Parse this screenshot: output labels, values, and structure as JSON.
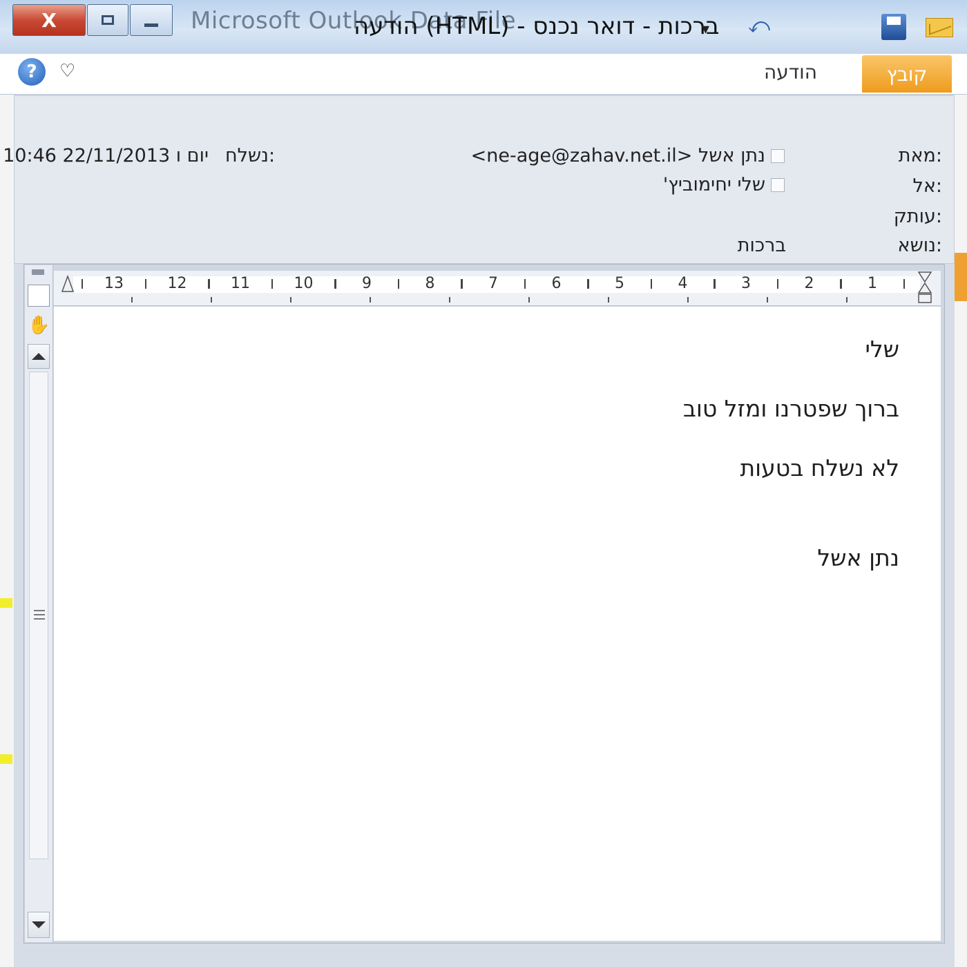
{
  "window": {
    "title": "הודעה (HTML) - ברכות - דואר נכנס",
    "background_title": "Microsoft Outlook Data File",
    "close_label": "X"
  },
  "ribbon": {
    "tabs": [
      {
        "label": "קובץ",
        "active": true
      },
      {
        "label": "הודעה",
        "active": false
      }
    ],
    "help_label": "?"
  },
  "header": {
    "from_label": "מאת:",
    "from_value": "נתן אשל <ne-age@zahav.net.il>",
    "to_label": "אל:",
    "to_value": "שלי יחימוביץ'",
    "cc_label": "עותק:",
    "subject_label": "נושא:",
    "subject_value": "ברכות",
    "sent_label": "נשלח:",
    "sent_value": "יום ו 22/11/2013 10:46"
  },
  "ruler": {
    "numbers": [
      "13",
      "12",
      "11",
      "10",
      "9",
      "8",
      "7",
      "6",
      "5",
      "4",
      "3",
      "2",
      "1"
    ]
  },
  "body": {
    "lines": [
      "שלי",
      "ברוך שפטרנו ומזל טוב",
      "לא נשלח בטעות",
      "נתן אשל"
    ]
  },
  "colors": {
    "file_tab": "#ef9b1c",
    "close_button": "#c94a35",
    "header_panel": "#e4e8ef"
  }
}
